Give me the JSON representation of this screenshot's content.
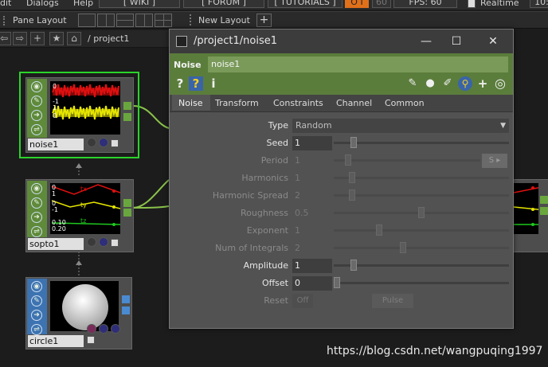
{
  "menubar": {
    "items": [
      "dit",
      "Dialogs",
      "Help"
    ],
    "wiki": "[ WIKI ]",
    "forum": "[ FORUM ]",
    "tutorials": "[ TUTORIALS ]",
    "badge": "O I",
    "fps_num": "60",
    "fps": "FPS:  60",
    "realtime": "Realtime",
    "right_num": "10:"
  },
  "panebar": {
    "pane_layout": "Pane Layout",
    "new_layout": "New Layout",
    "add": "+"
  },
  "pathbar": {
    "path": "/ project1"
  },
  "nodes": [
    {
      "name": "noise1",
      "labels": [
        "0",
        "-1",
        "1",
        "0"
      ]
    },
    {
      "name": "sopto1",
      "labels": [
        "tx",
        "0",
        "1",
        "ty",
        "0",
        "-1",
        "tz",
        "0.10",
        "0.20"
      ]
    },
    {
      "name": "circle1"
    }
  ],
  "param_window": {
    "title": "/project1/noise1",
    "op_type": "Noise",
    "op_name": "noise1",
    "tabs": [
      "Noise",
      "Transform",
      "Constraints",
      "Channel",
      "Common"
    ],
    "active_tab": "Noise",
    "params": [
      {
        "label": "Type",
        "value": "Random",
        "kind": "menu",
        "enabled": true
      },
      {
        "label": "Seed",
        "value": "1",
        "kind": "slider",
        "enabled": true,
        "slider_fraction": 0.1
      },
      {
        "label": "Period",
        "value": "1",
        "kind": "slider",
        "enabled": false,
        "slider_fraction": 0.08,
        "extra": "S"
      },
      {
        "label": "Harmonics",
        "value": "1",
        "kind": "slider",
        "enabled": false,
        "slider_fraction": 0.09
      },
      {
        "label": "Harmonic Spread",
        "value": "2",
        "kind": "slider",
        "enabled": false,
        "slider_fraction": 0.09
      },
      {
        "label": "Roughness",
        "value": "0.5",
        "kind": "slider",
        "enabled": false,
        "slider_fraction": 0.5
      },
      {
        "label": "Exponent",
        "value": "1",
        "kind": "slider",
        "enabled": false,
        "slider_fraction": 0.25
      },
      {
        "label": "Num of Integrals",
        "value": "2",
        "kind": "slider",
        "enabled": false,
        "slider_fraction": 0.39
      },
      {
        "label": "Amplitude",
        "value": "1",
        "kind": "slider",
        "enabled": true,
        "slider_fraction": 0.1
      },
      {
        "label": "Offset",
        "value": "0",
        "kind": "slider",
        "enabled": true,
        "slider_fraction": 0.0
      },
      {
        "label": "Reset",
        "value": "Off",
        "kind": "pulse",
        "enabled": false,
        "pulse_label": "Pulse"
      }
    ]
  },
  "watermark": "https://blog.csdn.net/wangpuqing1997",
  "colors": {
    "op_header": "#5b7d3c",
    "chop_node": "#5f8a3a",
    "sop_node": "#3d73b0",
    "selected_border": "#2ad42a",
    "noise_red": "#e01010",
    "noise_yellow": "#e6e600"
  },
  "icons": {
    "help": "question-mark",
    "python": "python-icon",
    "info": "info-icon",
    "edit": "pencil-icon",
    "comment": "speech-bubble-icon",
    "clear": "eraser-icon",
    "add": "plus-icon",
    "target": "target-icon"
  }
}
